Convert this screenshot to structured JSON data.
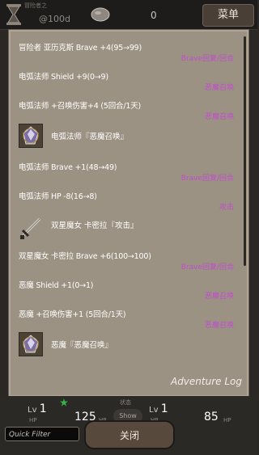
{
  "topbar": {
    "tiny_label": "冒险者之",
    "gold_text": "@100d",
    "stone_count": "0",
    "menu_label": "菜单"
  },
  "log": {
    "title": "Adventure Log",
    "entries": [
      {
        "text": "冒险者 亚历克斯 Brave +4(95→99)",
        "tag": "Brave回复/回合"
      },
      {
        "text": "电弧法师 Shield +9(0→9)",
        "tag": "恶魔召唤"
      },
      {
        "text": "电弧法师 +召唤伤害+4 (5回合/1天)",
        "tag": "恶魔召唤"
      },
      {
        "text": "电弧法师『恶魔召唤』",
        "tag": ""
      },
      {
        "text": "电弧法师 Brave +1(48→49)",
        "tag": "Brave回复/回合"
      },
      {
        "text": "电弧法师 HP -8(16→8)",
        "tag": "攻击"
      },
      {
        "text": "双星魔女 卡密拉『攻击』",
        "tag": ""
      },
      {
        "text": "双星魔女 卡密拉 Brave +6(100→100)",
        "tag": "Brave回复/回合"
      },
      {
        "text": "恶魔 Shield +1(0→1)",
        "tag": "恶魔召唤"
      },
      {
        "text": "恶魔 +召唤伤害+1 (5回合/1天)",
        "tag": "恶魔召唤"
      },
      {
        "text": "恶魔『恶魔召唤』",
        "tag": ""
      }
    ]
  },
  "bottom": {
    "left_lv_label": "Lv",
    "left_lv_value": "1",
    "left_hp_label": "HP",
    "left_hp_value": "125",
    "left_hp_unit": "HP",
    "center_label": "状态",
    "show_label": "Show",
    "right_lv_label": "Lv",
    "right_lv_value": "1",
    "right_hp_label": "HP",
    "right_hp_value": "85",
    "right_hp_unit": "HP",
    "quick_filter_placeholder": "Quick Filter",
    "close_label": "关闭"
  },
  "colors": {
    "panel_bg": "#9c9283",
    "tag_purple": "#c24bd0"
  }
}
